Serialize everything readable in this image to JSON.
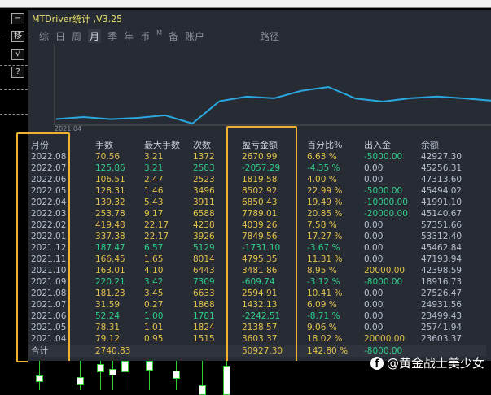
{
  "window": {
    "title": "MTDriver统计 ,V3.25"
  },
  "side_buttons": [
    "−",
    "移",
    "√",
    "?"
  ],
  "tabs": [
    {
      "label": "综"
    },
    {
      "label": "日"
    },
    {
      "label": "周"
    },
    {
      "label": "月",
      "active": true
    },
    {
      "label": "季"
    },
    {
      "label": "年"
    },
    {
      "label": "币"
    },
    {
      "label": "M"
    },
    {
      "label": "备"
    },
    {
      "label": "账户"
    },
    {
      "label": "路径"
    }
  ],
  "chart": {
    "x_start_label": "2021.04",
    "line_color": "#2aa8e0"
  },
  "table": {
    "headers": [
      "月份",
      "手数",
      "最大手数",
      "次数",
      "盈亏金额",
      "百分比%",
      "出入金",
      "余额"
    ],
    "rows": [
      [
        "2022.08",
        "70.56",
        "3.21",
        "1372",
        "2670.99",
        "6.63 %",
        "-5000.00",
        "42927.30"
      ],
      [
        "2022.07",
        "125.86",
        "3.21",
        "2583",
        "-2057.29",
        "-4.35 %",
        "0.00",
        "45256.31"
      ],
      [
        "2022.06",
        "106.51",
        "2.47",
        "2523",
        "1819.58",
        "4.00 %",
        "0.00",
        "47313.60"
      ],
      [
        "2022.05",
        "128.31",
        "1.46",
        "3496",
        "8502.92",
        "22.99 %",
        "-5000.00",
        "45494.02"
      ],
      [
        "2022.04",
        "139.32",
        "5.43",
        "3911",
        "6850.43",
        "19.49 %",
        "-10000.00",
        "41991.10"
      ],
      [
        "2022.03",
        "253.78",
        "9.17",
        "6588",
        "7789.01",
        "20.85 %",
        "-20000.00",
        "45140.67"
      ],
      [
        "2022.02",
        "419.48",
        "22.17",
        "4238",
        "4039.26",
        "7.58 %",
        "0.00",
        "57351.66"
      ],
      [
        "2022.01",
        "337.38",
        "22.17",
        "3926",
        "7849.56",
        "17.27 %",
        "0.00",
        "53312.40"
      ],
      [
        "2021.12",
        "187.47",
        "6.57",
        "5129",
        "-1731.10",
        "-3.67 %",
        "0.00",
        "45462.84"
      ],
      [
        "2021.11",
        "166.45",
        "1.65",
        "8014",
        "4795.35",
        "11.31 %",
        "0.00",
        "47193.94"
      ],
      [
        "2021.10",
        "163.01",
        "4.10",
        "6443",
        "3481.86",
        "8.95 %",
        "20000.00",
        "42398.59"
      ],
      [
        "2021.09",
        "220.21",
        "3.42",
        "7309",
        "-609.74",
        "-3.12 %",
        "-8000.00",
        "18916.73"
      ],
      [
        "2021.08",
        "181.23",
        "3.45",
        "6633",
        "2594.91",
        "10.41 %",
        "0.00",
        "27526.47"
      ],
      [
        "2021.07",
        "31.59",
        "0.27",
        "1868",
        "1432.13",
        "6.09 %",
        "0.00",
        "24931.56"
      ],
      [
        "2021.06",
        "52.24",
        "1.00",
        "1781",
        "-2242.51",
        "-8.71 %",
        "0.00",
        "23499.43"
      ],
      [
        "2021.05",
        "78.31",
        "1.01",
        "1824",
        "2138.57",
        "9.06 %",
        "0.00",
        "25741.94"
      ],
      [
        "2021.04",
        "79.12",
        "0.95",
        "1515",
        "3603.37",
        "18.02 %",
        "20000.00",
        "23603.37"
      ]
    ],
    "total": [
      "合计",
      "2740.83",
      "",
      "",
      "50927.30",
      "142.80 %",
      "-8000.00",
      ""
    ]
  },
  "watermark": "@黄金战士美少女",
  "colors": {
    "positive": "#e2c24a",
    "negative": "#2ecf8a",
    "highlight_box": "#f0b030"
  }
}
